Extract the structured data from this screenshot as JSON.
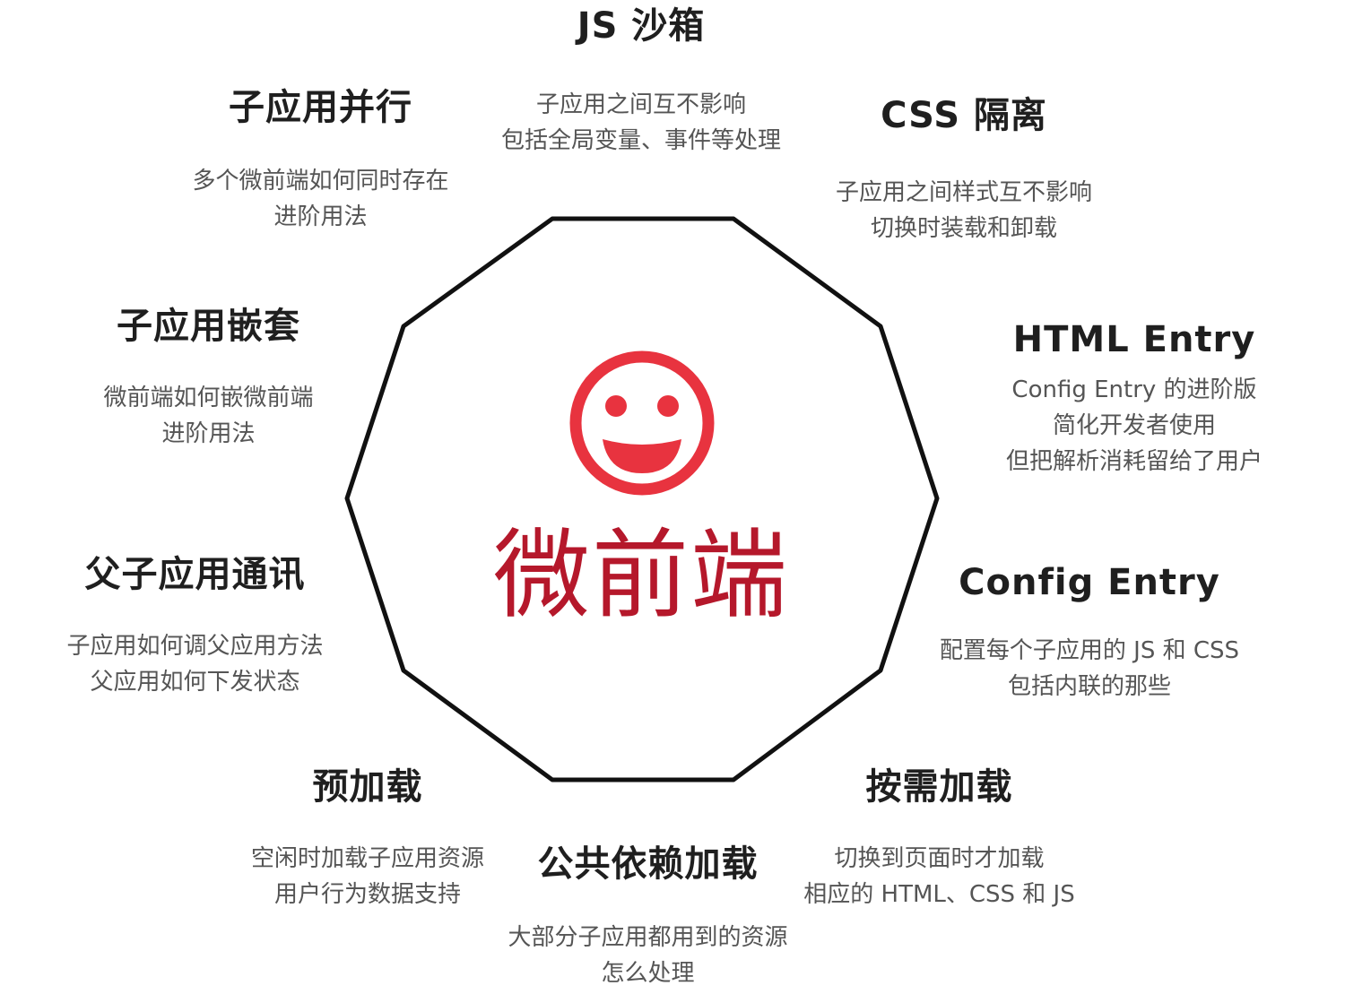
{
  "colors": {
    "outline": "#111111",
    "icon": "#e8333f",
    "center_title": "#b5182b",
    "title": "#1f1f1f",
    "description": "#555555"
  },
  "center": {
    "icon": "smiley-face-icon",
    "title": "微前端"
  },
  "features": {
    "js_sandbox": {
      "title": "JS 沙箱",
      "desc": [
        "子应用之间互不影响",
        "包括全局变量、事件等处理"
      ]
    },
    "css_isolation": {
      "title": "CSS 隔离",
      "desc": [
        "子应用之间样式互不影响",
        "切换时装载和卸载"
      ]
    },
    "html_entry": {
      "title": "HTML Entry",
      "desc": [
        "Config Entry 的进阶版",
        "简化开发者使用",
        "但把解析消耗留给了用户"
      ]
    },
    "config_entry": {
      "title": "Config Entry",
      "desc": [
        "配置每个子应用的 JS 和 CSS",
        "包括内联的那些"
      ]
    },
    "on_demand": {
      "title": "按需加载",
      "desc": [
        "切换到页面时才加载",
        "相应的 HTML、CSS 和 JS"
      ]
    },
    "shared_deps": {
      "title": "公共依赖加载",
      "desc": [
        "大部分子应用都用到的资源",
        "怎么处理"
      ]
    },
    "preload": {
      "title": "预加载",
      "desc": [
        "空闲时加载子应用资源",
        "用户行为数据支持"
      ]
    },
    "communication": {
      "title": "父子应用通讯",
      "desc": [
        "子应用如何调父应用方法",
        "父应用如何下发状态"
      ]
    },
    "nesting": {
      "title": "子应用嵌套",
      "desc": [
        "微前端如何嵌微前端",
        "进阶用法"
      ]
    },
    "parallel": {
      "title": "子应用并行",
      "desc": [
        "多个微前端如何同时存在",
        "进阶用法"
      ]
    }
  }
}
